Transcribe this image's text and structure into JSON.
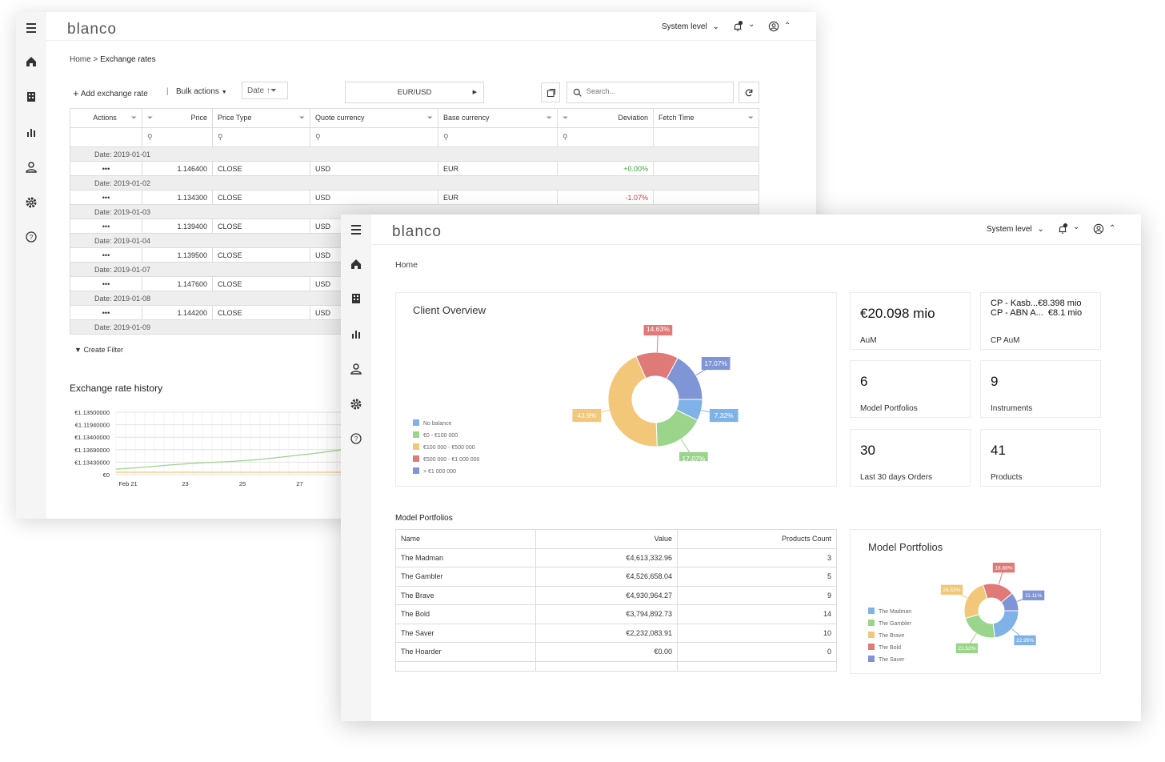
{
  "colors": {
    "blue": "#7f95d6",
    "green": "#9bd48b",
    "orange": "#f2c77a",
    "red": "#e07a79",
    "lightblue": "#7fb3e8",
    "positive": "#3aa83a",
    "negative": "#d63a3a"
  },
  "back": {
    "logo": "blanco",
    "system_level": "System level",
    "notif_count": "2",
    "breadcrumb": {
      "home": "Home",
      "separator": " > ",
      "current": "Exchange rates"
    },
    "toolbar": {
      "add": "Add exchange rate",
      "separator": "|",
      "bulk": "Bulk actions",
      "date": "Date",
      "pair": "EUR/USD",
      "search_placeholder": "Search..."
    },
    "columns": [
      "Actions",
      "Price",
      "Price Type",
      "Quote currency",
      "Base currency",
      "Deviation",
      "Fetch Time"
    ],
    "rows": [
      {
        "date": "Date: 2019-01-01",
        "actions": "•••",
        "price": "1.146400",
        "type": "CLOSE",
        "quote": "USD",
        "base": "EUR",
        "deviation": "+0.00%",
        "fetch": ""
      },
      {
        "date": "Date: 2019-01-02",
        "actions": "•••",
        "price": "1.134300",
        "type": "CLOSE",
        "quote": "USD",
        "base": "EUR",
        "deviation": "-1.07%",
        "fetch": ""
      },
      {
        "date": "Date: 2019-01-03",
        "actions": "•••",
        "price": "1.139400",
        "type": "CLOSE",
        "quote": "USD",
        "base": "",
        "deviation": "",
        "fetch": ""
      },
      {
        "date": "Date: 2019-01-04",
        "actions": "•••",
        "price": "1.139500",
        "type": "CLOSE",
        "quote": "USD",
        "base": "",
        "deviation": "",
        "fetch": ""
      },
      {
        "date": "Date: 2019-01-07",
        "actions": "•••",
        "price": "1.147600",
        "type": "CLOSE",
        "quote": "USD",
        "base": "",
        "deviation": "",
        "fetch": ""
      },
      {
        "date": "Date: 2019-01-08",
        "actions": "•••",
        "price": "1.144200",
        "type": "CLOSE",
        "quote": "USD",
        "base": "",
        "deviation": "",
        "fetch": ""
      }
    ],
    "last_group": "Date: 2019-01-09",
    "create_filter": "Create Filter",
    "history_title": "Exchange rate history"
  },
  "front": {
    "logo": "blanco",
    "system_level": "System level",
    "notif_count": "2",
    "breadcrumb": "Home",
    "client_overview_title": "Client Overview",
    "kpis": [
      {
        "value": "€20.098 mio",
        "label": "AuM"
      },
      {
        "value_line1": "CP - Kasb...€8.398 mio",
        "value_line2": "CP - ABN A...  €8.1 mio",
        "label": "CP AuM"
      },
      {
        "value": "6",
        "label": "Model Portfolios"
      },
      {
        "value": "9",
        "label": "Instruments"
      },
      {
        "value": "30",
        "label": "Last 30 days Orders"
      },
      {
        "value": "41",
        "label": "Products"
      }
    ],
    "mp_section_title": "Model Portfolios",
    "mp_columns": [
      "Name",
      "Value",
      "Products Count"
    ],
    "mp_rows": [
      {
        "name": "The Madman",
        "value": "€4,613,332.96",
        "count": "3"
      },
      {
        "name": "The Gambler",
        "value": "€4,526,658.04",
        "count": "5"
      },
      {
        "name": "The Brave",
        "value": "€4,930,964.27",
        "count": "9"
      },
      {
        "name": "The Bold",
        "value": "€3,794,892.73",
        "count": "14"
      },
      {
        "name": "The Saver",
        "value": "€2,232,083.91",
        "count": "10"
      },
      {
        "name": "The Hoarder",
        "value": "€0.00",
        "count": "0"
      }
    ],
    "mp_chart_title": "Model Portfolios"
  },
  "chart_data": [
    {
      "type": "line",
      "title": "Exchange rate history",
      "y_tick_labels": [
        "€1.13500000",
        "€1.11940000",
        "€1.13400000",
        "€1.13690000",
        "€1.13430000",
        "€0"
      ],
      "x_tick_labels": [
        "Feb 21",
        "23",
        "25",
        "27"
      ],
      "grid": true,
      "series": [
        {
          "color": "#9bd48b",
          "values": [
            0.05,
            0.08,
            0.12,
            0.15,
            0.17,
            0.2,
            0.25,
            0.3,
            0.36
          ]
        },
        {
          "color": "#f2c77a",
          "values": [
            0,
            0,
            0,
            0,
            0,
            0,
            0,
            0,
            0
          ]
        }
      ]
    },
    {
      "type": "pie",
      "title": "Client Overview",
      "legend_position": "left",
      "categories": [
        "No balance",
        "€0 - €100 000",
        "€100 000 - €500 000",
        "€500 000 - €1 000 000",
        "> €1 000 000"
      ],
      "values": [
        7.32,
        17.07,
        43.9,
        14.63,
        17.07
      ],
      "labels": [
        "7.32%",
        "17.07%",
        "43.9%",
        "14.63%",
        "17.07%"
      ],
      "colors": [
        "#7fb3e8",
        "#9bd48b",
        "#f2c77a",
        "#e07a79",
        "#7f95d6"
      ]
    },
    {
      "type": "pie",
      "title": "Model Portfolios",
      "legend_position": "left",
      "categories": [
        "The Madman",
        "The Gambler",
        "The Brave",
        "The Bold",
        "The Saver"
      ],
      "values": [
        22.95,
        22.52,
        24.53,
        18.88,
        11.11
      ],
      "labels": [
        "22.95%",
        "22.52%",
        "24.53%",
        "18.88%",
        "11.11%"
      ],
      "colors": [
        "#7fb3e8",
        "#9bd48b",
        "#f2c77a",
        "#e07a79",
        "#7f95d6"
      ]
    }
  ]
}
